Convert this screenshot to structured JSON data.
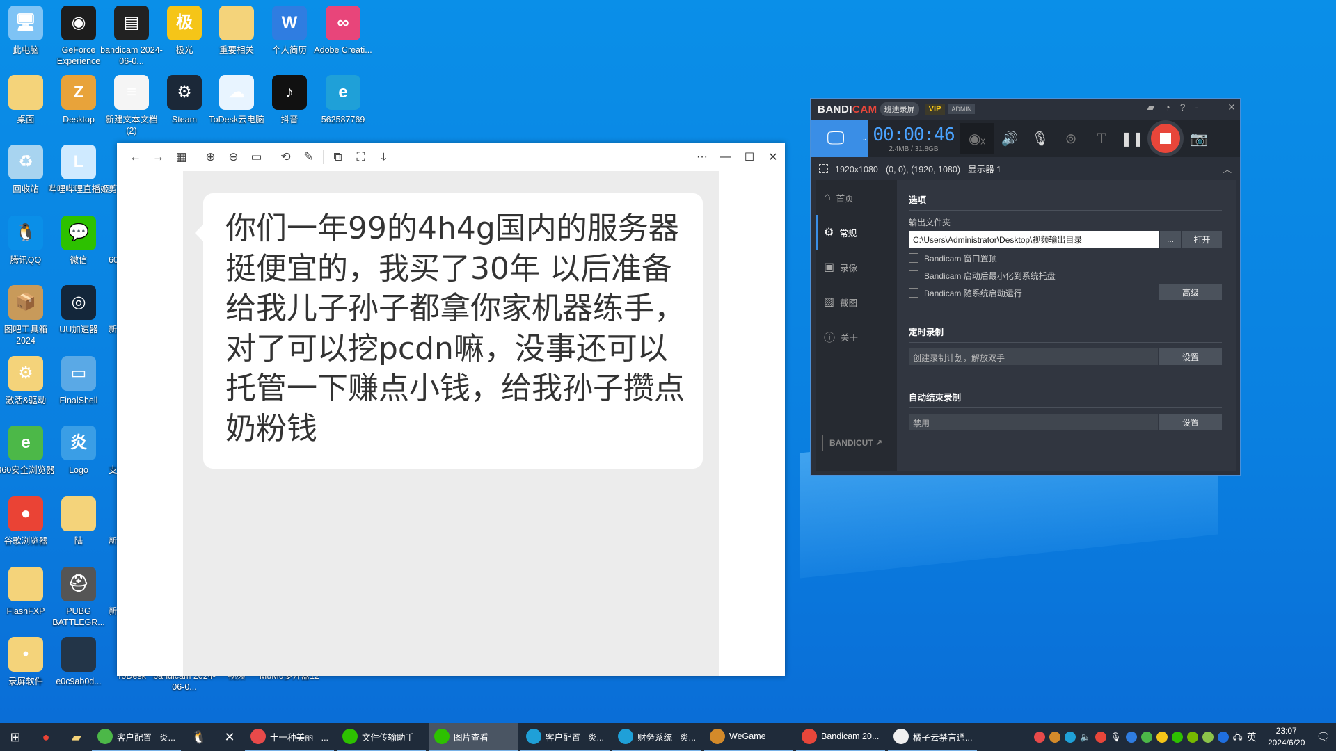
{
  "desktop": {
    "icons": [
      {
        "label": "此电脑",
        "icon": "computer-icon",
        "color": "#7ec3f5",
        "glyph": "🖥"
      },
      {
        "label": "GeForce Experience",
        "icon": "nvidia-icon",
        "color": "#1d1d1d",
        "glyph": "◉"
      },
      {
        "label": "bandicam 2024-06-0...",
        "icon": "video-file-icon",
        "color": "#222",
        "glyph": "▤"
      },
      {
        "label": "极光",
        "icon": "jiguang-icon",
        "color": "#f5c518",
        "glyph": "极"
      },
      {
        "label": "重要相关",
        "icon": "folder-icon",
        "color": "#f4d37a",
        "glyph": ""
      },
      {
        "label": "个人简历",
        "icon": "word-doc-icon",
        "color": "#2f7de1",
        "glyph": "W"
      },
      {
        "label": "Adobe Creati...",
        "icon": "adobe-cc-icon",
        "color": "#e8457a",
        "glyph": "∞"
      },
      {
        "label": "桌面",
        "icon": "folder-icon",
        "color": "#f4d37a",
        "glyph": ""
      },
      {
        "label": "Desktop",
        "icon": "zip-icon",
        "color": "#e8a33a",
        "glyph": "Z"
      },
      {
        "label": "新建文本文档 (2)",
        "icon": "text-file-icon",
        "color": "#f5f5f5",
        "glyph": "≡"
      },
      {
        "label": "Steam",
        "icon": "steam-icon",
        "color": "#1b2838",
        "glyph": "⚙"
      },
      {
        "label": "ToDesk云电脑",
        "icon": "todesk-icon",
        "color": "#e8f4ff",
        "glyph": "☁"
      },
      {
        "label": "抖音",
        "icon": "tiktok-icon",
        "color": "#111",
        "glyph": "♪"
      },
      {
        "label": "562587769",
        "icon": "edge-icon",
        "color": "#1fa0d8",
        "glyph": "e"
      },
      {
        "label": "回收站",
        "icon": "recycle-bin-icon",
        "color": "#a8d4f0",
        "glyph": "♻"
      },
      {
        "label": "哔哩哔哩直播姬",
        "icon": "bilibili-live-icon",
        "color": "#cfeaff",
        "glyph": "L"
      },
      {
        "label": "腾讯QQ",
        "icon": "qq-icon",
        "color": "#0a8fe8",
        "glyph": "🐧"
      },
      {
        "label": "微信",
        "icon": "wechat-icon",
        "color": "#2dc100",
        "glyph": "💬"
      },
      {
        "label": "图吧工具箱 2024",
        "icon": "toolbox-icon",
        "color": "#c89a5a",
        "glyph": "📦"
      },
      {
        "label": "UU加速器",
        "icon": "uu-icon",
        "color": "#13263a",
        "glyph": "◎"
      },
      {
        "label": "激活&驱动",
        "icon": "folder-icon",
        "color": "#f4d37a",
        "glyph": "⚙"
      },
      {
        "label": "FinalShell",
        "icon": "finalshell-icon",
        "color": "#5aa9e6",
        "glyph": "▭"
      },
      {
        "label": "360安全浏览器",
        "icon": "360-browser-icon",
        "color": "#4cb848",
        "glyph": "e"
      },
      {
        "label": "Logo",
        "icon": "image-file-icon",
        "color": "#3a9ee6",
        "glyph": "炎"
      },
      {
        "label": "谷歌浏览器",
        "icon": "chrome-icon",
        "color": "#ea4335",
        "glyph": "●"
      },
      {
        "label": "陆",
        "icon": "folder-icon",
        "color": "#f4d37a",
        "glyph": ""
      },
      {
        "label": "FlashFXP",
        "icon": "folder-icon",
        "color": "#f4d37a",
        "glyph": ""
      },
      {
        "label": "PUBG BATTLEGR...",
        "icon": "pubg-icon",
        "color": "#555",
        "glyph": "⛑"
      },
      {
        "label": "录屏软件",
        "icon": "folder-icon",
        "color": "#f4d37a",
        "glyph": "•"
      },
      {
        "label": "e0c9ab0d...",
        "icon": "image-file-icon",
        "color": "#233548",
        "glyph": ""
      }
    ],
    "partial_icons": [
      {
        "label": "剪"
      },
      {
        "label": "60"
      },
      {
        "label": "新"
      },
      {
        "label": "支付宝"
      },
      {
        "label": "新"
      },
      {
        "label": "新"
      }
    ],
    "bottom_labels": [
      {
        "label": "ToDesk"
      },
      {
        "label": "bandicam 2024-06-0..."
      },
      {
        "label": "视频"
      },
      {
        "label": "MuMu多开器12"
      }
    ]
  },
  "viewer": {
    "message": "你们一年99的4h4g国内的服务器挺便宜的，我买了30年 以后准备给我儿子孙子都拿你家机器练手，对了可以挖pcdn嘛，没事还可以托管一下赚点小钱，给我孙子攒点奶粉钱",
    "toolbar": [
      "back-icon",
      "forward-icon",
      "grid-icon",
      "zoom-in-icon",
      "zoom-out-icon",
      "actual-size-icon",
      "rotate-icon",
      "edit-icon",
      "translate-icon",
      "ocr-icon",
      "save-icon"
    ],
    "more": "···",
    "min": "—",
    "max": "☐",
    "close": "✕"
  },
  "bandicam": {
    "logo_a": "BANDI",
    "logo_b": "CAM",
    "brand_cn": "班迪录屏",
    "vip": "VIP",
    "admin": "ADMIN",
    "timer": "00:00:46",
    "size": "2.4MB / 31.8GB",
    "region": "1920x1080 - (0, 0), (1920, 1080) - 显示器 1",
    "nav": [
      {
        "label": "首页",
        "icon": "home-icon",
        "glyph": "⌂"
      },
      {
        "label": "常规",
        "icon": "gear-icon",
        "glyph": "⚙"
      },
      {
        "label": "录像",
        "icon": "video-settings-icon",
        "glyph": "▣"
      },
      {
        "label": "截图",
        "icon": "screenshot-settings-icon",
        "glyph": "▨"
      },
      {
        "label": "关于",
        "icon": "info-icon",
        "glyph": "ⓘ"
      }
    ],
    "active_nav": "常规",
    "bandicut": "BANDICUT ↗",
    "options_title": "选项",
    "output_label": "输出文件夹",
    "output_path": "C:\\Users\\Administrator\\Desktop\\视频输出目录",
    "browse": "...",
    "open": "打开",
    "checkboxes": [
      {
        "label": "Bandicam 窗口置顶",
        "checked": false
      },
      {
        "label": "Bandicam 启动后最小化到系统托盘",
        "checked": false
      },
      {
        "label": "Bandicam 随系统启动运行",
        "checked": false
      }
    ],
    "advanced": "高级",
    "schedule_title": "定时录制",
    "schedule_text": "创建录制计划，解放双手",
    "schedule_btn": "设置",
    "autostop_title": "自动结束录制",
    "autostop_text": "禁用",
    "autostop_btn": "设置",
    "accent": "#3a8ee6",
    "record_color": "#e8463a"
  },
  "taskbar": {
    "apps": [
      {
        "label": "客户配置 - 炎...",
        "color": "#4cb848",
        "active": false
      },
      {
        "label": "十一种美丽 - ...",
        "color": "#e84a4a",
        "active": false
      },
      {
        "label": "文件传输助手",
        "color": "#2dc100",
        "active": false
      },
      {
        "label": "图片查看",
        "color": "#2dc100",
        "active": true
      },
      {
        "label": "客户配置 - 炎...",
        "color": "#1fa0d8",
        "active": false
      },
      {
        "label": "财务系统 - 炎...",
        "color": "#1fa0d8",
        "active": false
      },
      {
        "label": "WeGame",
        "color": "#d38a2a",
        "active": false
      },
      {
        "label": "Bandicam 20...",
        "color": "#e8463a",
        "active": false
      },
      {
        "label": "橘子云禁言通...",
        "color": "#f0f0f0",
        "active": false
      }
    ],
    "ime": "英",
    "time": "23:07",
    "date": "2024/6/20"
  }
}
